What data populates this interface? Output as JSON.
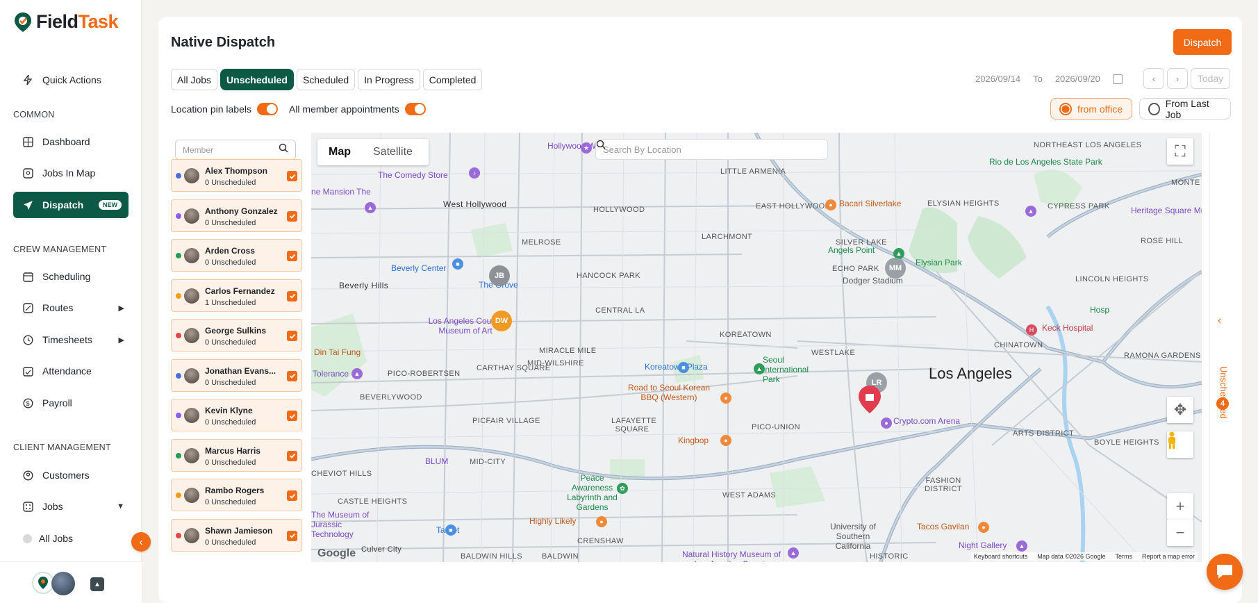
{
  "brand": {
    "name_part1": "Field",
    "name_part2": "Task"
  },
  "colors": {
    "accent": "#f16a15",
    "primary": "#0c5a46"
  },
  "sidebar": {
    "quick_actions": "Quick Actions",
    "sections": {
      "common": "COMMON",
      "crew": "CREW MANAGEMENT",
      "client": "CLIENT MANAGEMENT"
    },
    "common_items": [
      {
        "label": "Dashboard",
        "icon": "grid-icon"
      },
      {
        "label": "Jobs In Map",
        "icon": "map-icon"
      },
      {
        "label": "Dispatch",
        "icon": "send-icon",
        "badge": "NEW",
        "active": true
      }
    ],
    "crew_items": [
      {
        "label": "Scheduling",
        "icon": "calendar-icon"
      },
      {
        "label": "Routes",
        "icon": "route-icon"
      },
      {
        "label": "Timesheets",
        "icon": "clock-icon"
      },
      {
        "label": "Attendance",
        "icon": "attendance-icon"
      },
      {
        "label": "Payroll",
        "icon": "payroll-icon"
      }
    ],
    "client_items": [
      {
        "label": "Customers",
        "icon": "customers-icon"
      },
      {
        "label": "Jobs",
        "icon": "jobs-icon"
      }
    ],
    "jobs_sub": {
      "all_jobs": "All Jobs"
    }
  },
  "header": {
    "title": "Native Dispatch",
    "dispatch_button": "Dispatch"
  },
  "tabs": [
    {
      "label": "All Jobs",
      "active": false
    },
    {
      "label": "Unscheduled",
      "active": true
    },
    {
      "label": "Scheduled",
      "active": false
    },
    {
      "label": "In Progress",
      "active": false
    },
    {
      "label": "Completed",
      "active": false
    }
  ],
  "date_range": {
    "from": "2026/09/14",
    "to_label": "To",
    "to": "2026/09/20",
    "today": "Today"
  },
  "toggles": {
    "pin_labels": "Location pin labels",
    "member_appointments": "All member appointments"
  },
  "route_origin": {
    "office": "from office",
    "last_job": "From Last Job",
    "selected": "office"
  },
  "member_search": {
    "placeholder": "Member"
  },
  "members": [
    {
      "name": "Alex Thompson",
      "count": "0 Unscheduled",
      "color": "#4a6ee0"
    },
    {
      "name": "Anthony Gonzalez",
      "count": "0 Unscheduled",
      "color": "#8b5cf6"
    },
    {
      "name": "Arden Cross",
      "count": "0 Unscheduled",
      "color": "#1f9d55"
    },
    {
      "name": "Carlos Fernandez",
      "count": "1 Unscheduled",
      "color": "#f59e0b"
    },
    {
      "name": "George Sulkins",
      "count": "0 Unscheduled",
      "color": "#e04848"
    },
    {
      "name": "Jonathan Evans...",
      "count": "0 Unscheduled",
      "color": "#4a6ee0"
    },
    {
      "name": "Kevin Klyne",
      "count": "0 Unscheduled",
      "color": "#8b5cf6"
    },
    {
      "name": "Marcus Harris",
      "count": "0 Unscheduled",
      "color": "#1f9d55"
    },
    {
      "name": "Rambo Rogers",
      "count": "0 Unscheduled",
      "color": "#f59e0b"
    },
    {
      "name": "Shawn Jamieson",
      "count": "0 Unscheduled",
      "color": "#e04848"
    }
  ],
  "map": {
    "type_map": "Map",
    "type_satellite": "Satellite",
    "search_placeholder": "Search By Location",
    "city_label": "Los Angeles",
    "pins": [
      "JB",
      "DW",
      "MM",
      "LR"
    ],
    "labels": {
      "hollywood_walk": "Hollywood Walk of Fame",
      "comedy_store": "The Comedy Store",
      "little_armenia": "LITTLE ARMENIA",
      "west_hollywood": "West Hollywood",
      "east_hollywood": "EAST HOLLYWOOD",
      "melrose": "MELROSE",
      "beverly_center": "Beverly Center",
      "the_grove": "The Grove",
      "beverly_hills": "Beverly Hills",
      "hancock_park": "HANCOCK PARK",
      "larchmont": "LARCHMONT",
      "lacma": "Los Angeles County Museum of Art",
      "central_la": "CENTRAL LA",
      "miracle_mile": "MIRACLE MILE",
      "mid_wilshire": "MID-WILSHIRE",
      "koreatown": "KOREATOWN",
      "koreatown_plaza": "Koreatown Plaza",
      "seoul_park": "Seoul International Park",
      "westlake": "WESTLAKE",
      "silver_lake": "SILVER LAKE",
      "echo_park": "ECHO PARK",
      "elysian": "ELYSIAN HEIGHTS",
      "dodger": "Dodger Stadium",
      "angels_point": "Angels Point",
      "elysian_park": "Elysian Park",
      "rio_de_los": "Rio de Los Angeles State Park",
      "cypress_park": "CYPRESS PARK",
      "heritage": "Heritage Square Mu",
      "rose_hill": "ROSE HILL",
      "lincoln": "LINCOLN HEIGHTS",
      "chinatown": "CHINATOWN",
      "keck": "Keck Hospital",
      "ramona": "RAMONA GARDENS",
      "crypto": "Crypto.com Arena",
      "arts": "ARTS DISTRICT",
      "boyle": "BOYLE HEIGHTS",
      "fashion": "FASHION DISTRICT",
      "tacos": "Tacos Gavilan",
      "night_gallery": "Night Gallery",
      "usc": "University of Southern California",
      "nhm": "Natural History Museum of Los Angeles County",
      "highly_likely": "Highly Likely",
      "target": "Target",
      "museum_tech": "The Museum of Jurassic Technology",
      "castle": "CASTLE HEIGHTS",
      "cheviot": "CHEVIOT HILLS",
      "mid_city": "MID-CITY",
      "picfair": "PICFAIR VILLAGE",
      "lafayette": "LAFAYETTE SQUARE",
      "west_adams": "WEST ADAMS",
      "peace": "Peace Awareness Labyrinth and Gardens",
      "kingbop": "Kingbop",
      "road_seoul": "Road to Seoul Korean BBQ (Western)",
      "pico_union": "PICO-UNION",
      "carthay": "CARTHAY SQUARE",
      "pico_robertsen": "PICO-ROBERTSEN",
      "beverlywood": "BEVERLYWOOD",
      "din_tai_fung": "Din Tai Fung",
      "tolerance": "Tolerance",
      "culver": "Culver City",
      "baldwin_hills": "BALDWIN HILLS",
      "baldwin": "BALDWIN",
      "crenshaw": "CRENSHAW",
      "historic": "HISTORIC",
      "bacari": "Bacari Silverlake",
      "northeast_la": "NORTHEAST LOS ANGELES",
      "montecito": "MONTE",
      "hollywood": "HOLLYWOOD",
      "blum": "BLUM",
      "alhambra_hosp": "Hosp",
      "mansion": "ne Mansion The"
    },
    "footer": {
      "google": "Google",
      "shortcuts": "Keyboard shortcuts",
      "map_data": "Map data ©2026 Google",
      "terms": "Terms",
      "report": "Report a map error"
    }
  },
  "unscheduled_rail": {
    "label": "Unscheduled",
    "count": "4"
  }
}
